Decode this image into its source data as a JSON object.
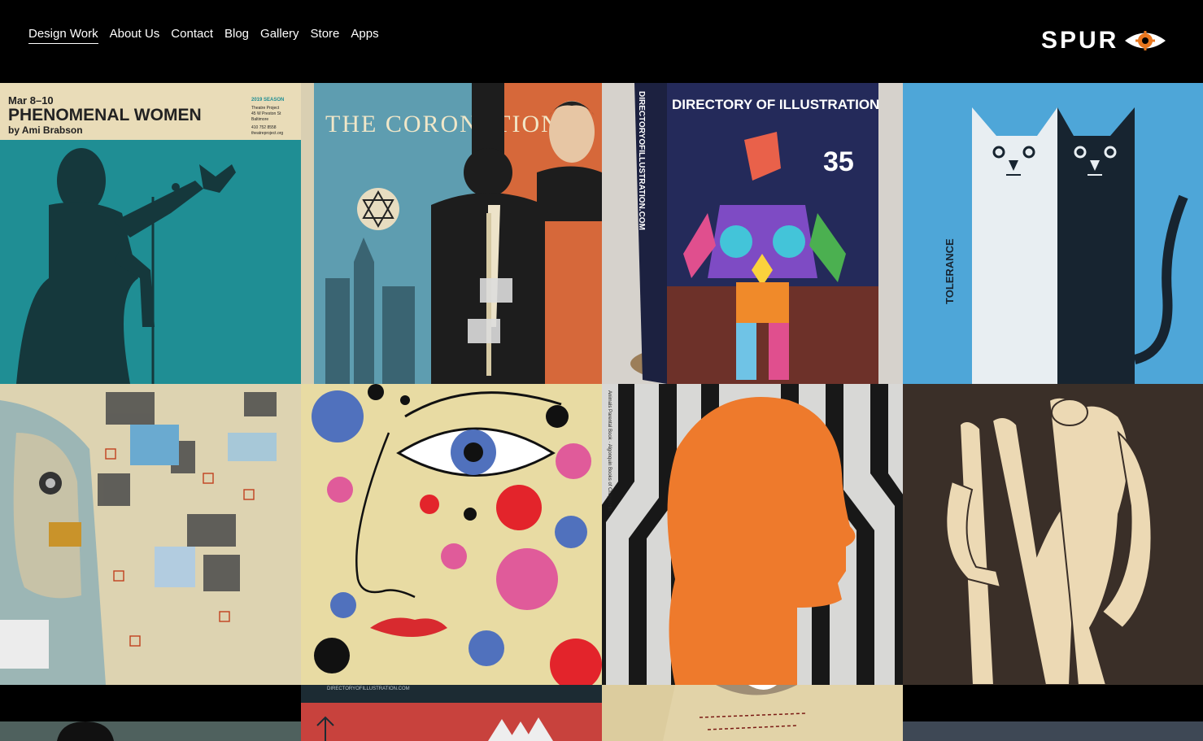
{
  "nav": {
    "items": [
      {
        "label": "Design Work",
        "active": true
      },
      {
        "label": "About Us"
      },
      {
        "label": "Contact"
      },
      {
        "label": "Blog"
      },
      {
        "label": "Gallery"
      },
      {
        "label": "Store"
      },
      {
        "label": "Apps"
      }
    ]
  },
  "logo": {
    "text": "SPUR",
    "icon": "eye-icon",
    "accent": "#e8761e"
  },
  "tiles": {
    "t1": {
      "date": "Mar 8–10",
      "title": "PHENOMENAL WOMEN",
      "author": "by Ami Brabson",
      "season": "2019 SEASON",
      "venue": [
        "Theatre Project",
        "45 W Preston St",
        "Baltimore"
      ],
      "phone": "410 752 8558",
      "site": "theatreproject.org"
    },
    "t2": {
      "title": "THE CORONATION"
    },
    "t3": {
      "title": "DIRECTORY OF ILLUSTRATION",
      "number": "35",
      "spine": "DIRECTORYOFILLUSTRATION.COM"
    },
    "t4": {
      "title": "TOLERANCE"
    },
    "t7": {
      "spine": "Animals Parental Book · Algonquin Books of Chapel Hill"
    },
    "t10": {
      "site": "DIRECTORYOFILLUSTRATION.COM"
    }
  }
}
